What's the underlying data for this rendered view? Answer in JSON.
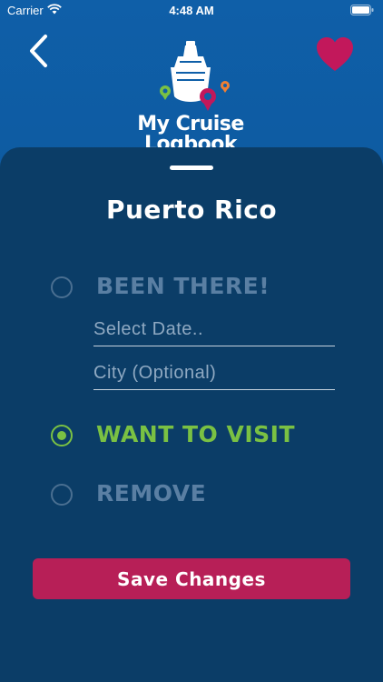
{
  "status_bar": {
    "carrier": "Carrier",
    "time": "4:48 AM",
    "icons": [
      "wifi-icon",
      "battery-icon"
    ]
  },
  "header": {
    "back_icon": "chevron-left-icon",
    "favorite_icon": "heart-icon",
    "logo": {
      "line1": "My Cruise",
      "line2": "Logbook"
    }
  },
  "sheet": {
    "title": "Puerto Rico",
    "options": [
      {
        "label": "BEEN THERE!",
        "selected": false
      },
      {
        "label": "WANT TO VISIT",
        "selected": true
      },
      {
        "label": "REMOVE",
        "selected": false
      }
    ],
    "date_field": {
      "placeholder": "Select Date..",
      "value": ""
    },
    "city_field": {
      "placeholder": "City (Optional)",
      "value": ""
    },
    "save_label": "Save Changes"
  },
  "colors": {
    "header_blue": "#0f5fa8",
    "sheet_navy": "#0b3d67",
    "selected_green": "#7ac143",
    "inactive_label": "#5a7fa3",
    "button_magenta": "#b71f57",
    "heart": "#c2185b"
  }
}
